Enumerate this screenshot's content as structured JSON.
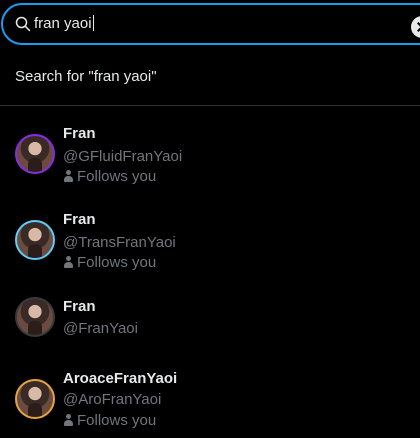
{
  "search": {
    "value": "fran yaoi",
    "icon": "search-icon"
  },
  "search_for": {
    "label": "Search for \"fran yaoi\""
  },
  "colors": {
    "accent": "#1d9bf0",
    "background": "#000000",
    "primary_text": "#e7e9ea",
    "secondary_text": "#71767b",
    "divider": "#2f3336"
  },
  "results": [
    {
      "name": "Fran",
      "handle": "@GFluidFranYaoi",
      "follows_you": "Follows you",
      "ring_color": "#8a2be2"
    },
    {
      "name": "Fran",
      "handle": "@TransFranYaoi",
      "follows_you": "Follows you",
      "ring_color": "#5bcefa"
    },
    {
      "name": "Fran",
      "handle": "@FranYaoi",
      "follows_you": null,
      "ring_color": "#3a3a3a"
    },
    {
      "name": "AroaceFranYaoi",
      "handle": "@AroFranYaoi",
      "follows_you": "Follows you",
      "ring_color": "#e8a33d"
    }
  ]
}
